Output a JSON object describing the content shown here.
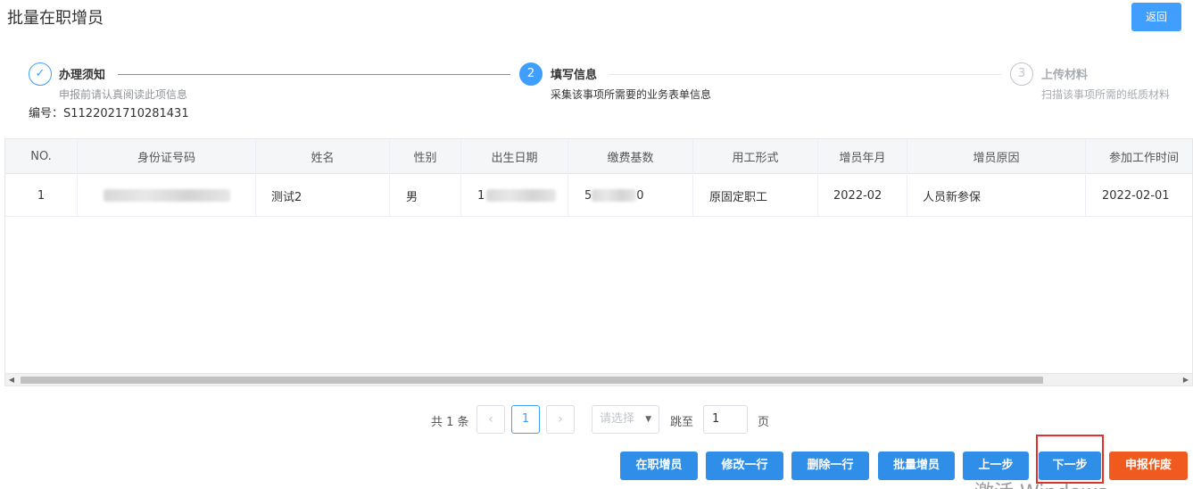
{
  "page": {
    "title": "批量在职增员",
    "back_label": "返回"
  },
  "steps": [
    {
      "index": "✓",
      "title": "办理须知",
      "desc": "申报前请认真阅读此项信息",
      "state": "done"
    },
    {
      "index": "2",
      "title": "填写信息",
      "desc": "采集该事项所需要的业务表单信息",
      "state": "active"
    },
    {
      "index": "3",
      "title": "上传材料",
      "desc": "扫描该事项所需的纸质材料",
      "state": "wait"
    }
  ],
  "serial": "编号：S1122021710281431",
  "table": {
    "columns": [
      "NO.",
      "身份证号码",
      "姓名",
      "性别",
      "出生日期",
      "缴费基数",
      "用工形式",
      "增员年月",
      "增员原因",
      "参加工作时间"
    ],
    "rows": [
      {
        "no": "1",
        "id_number": "[redacted]",
        "name": "测试2",
        "gender": "男",
        "birth": "1[redacted]",
        "base": "5[redacted]0",
        "employment": "原固定职工",
        "month": "2022-02",
        "reason": "人员新参保",
        "work_start": "2022-02-01"
      }
    ],
    "birth_visible": "1",
    "base_visible_a": "5",
    "base_visible_b": "0"
  },
  "pagination": {
    "total": "共 1 条",
    "prev": "‹",
    "current": "1",
    "next": "›",
    "page_size_placeholder": "请选择",
    "jump_label": "跳至",
    "jump_value": "1",
    "unit": "页"
  },
  "actions": {
    "add_employee": "在职增员",
    "edit_row": "修改一行",
    "delete_row": "删除一行",
    "batch_add": "批量增员",
    "prev_step": "上一步",
    "next_step": "下一步",
    "void_declaration": "申报作废"
  },
  "colors": {
    "primary": "#409eff",
    "button": "#2f8ee8",
    "danger": "#f05a1f",
    "highlight": "#e0322a"
  },
  "watermark": "激活 Windows"
}
